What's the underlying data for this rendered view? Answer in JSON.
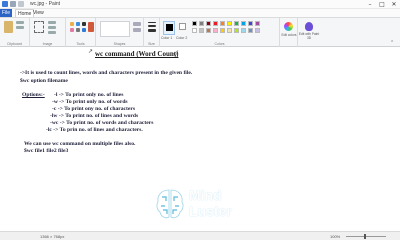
{
  "window": {
    "title": "wc.jpg - Paint",
    "minimize": "–",
    "maximize": "□",
    "close": "✕"
  },
  "menu": {
    "file": "File",
    "tabs": [
      "Home",
      "View"
    ]
  },
  "ribbon": {
    "groups": [
      "Clipboard",
      "Image",
      "Tools",
      "Shapes",
      "Size",
      "Colors"
    ],
    "color1": "Color 1",
    "color2": "Color 2",
    "edit_colors": "Edit colors",
    "edit_paint3d": "Edit with Paint 3D",
    "palette": [
      "#000000",
      "#7f7f7f",
      "#880015",
      "#ed1c24",
      "#ff7f27",
      "#fff200",
      "#22b14c",
      "#00a2e8",
      "#3f48cc",
      "#a349a4",
      "#ffffff",
      "#c3c3c3",
      "#b97a57",
      "#ffaec9",
      "#ffc90e",
      "#efe4b0",
      "#b5e61d",
      "#99d9ea",
      "#7092be",
      "#c8bfe7"
    ]
  },
  "document": {
    "heading": "wc command (Word Count)",
    "intro": "->It is used to count lines, words and characters present in the given file.",
    "syntax": "$wc  option  filename",
    "options_label": "Options:-",
    "options": [
      "-l -> To print only no. of lines",
      "-w -> To print only no. of words",
      "-c -> To print ony no. of characters",
      "-lw -> To print no. of lines and words",
      "-wc -> To print no. of words and characters",
      "-lc -> To prin no. of lines and characters."
    ],
    "multi_note": "We can use wc command on multiple files also.",
    "multi_example": "$wc file1 file2 file3"
  },
  "watermark": {
    "line1": "Mind",
    "line2": "Luster"
  },
  "status": {
    "size": "1366 × 768px",
    "zoom": "100%"
  }
}
